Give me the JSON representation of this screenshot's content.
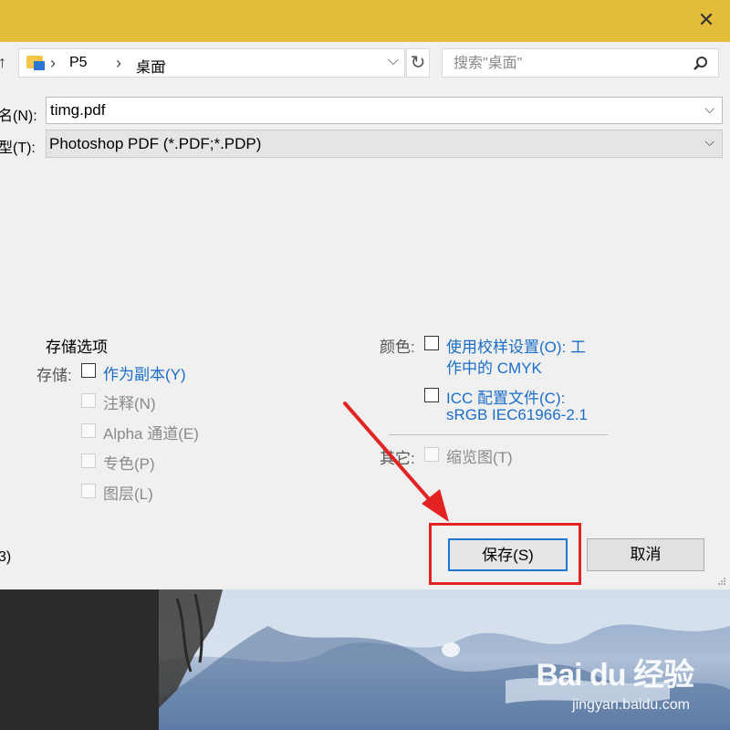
{
  "window": {
    "close_glyph": "✕"
  },
  "address": {
    "breadcrumbs": [
      "P5",
      "桌面"
    ],
    "separator": "›",
    "search_placeholder": "搜索\"桌面\""
  },
  "form": {
    "filename_label": "名(N):",
    "filename_value": "timg.pdf",
    "filetype_label": "型(T):",
    "filetype_value": "Photoshop PDF (*.PDF;*.PDP)"
  },
  "storage": {
    "title": "存储选项",
    "label": "存储:",
    "options": [
      {
        "label": "作为副本(Y)",
        "checked": false,
        "enabled": true
      },
      {
        "label": "注释(N)",
        "checked": false,
        "enabled": false
      },
      {
        "label": "Alpha 通道(E)",
        "checked": false,
        "enabled": false
      },
      {
        "label": "专色(P)",
        "checked": false,
        "enabled": false
      },
      {
        "label": "图层(L)",
        "checked": false,
        "enabled": false
      }
    ]
  },
  "color": {
    "label": "颜色:",
    "proof_line1": "使用校样设置(O):  工",
    "proof_line2": "作中的 CMYK",
    "icc_line1": "ICC 配置文件(C):",
    "icc_line2": "sRGB IEC61966-2.1"
  },
  "other": {
    "label": "其它:",
    "thumbnail": "缩览图(T)"
  },
  "buttons": {
    "save": "保存(S)",
    "cancel": "取消"
  },
  "left_partial": "3)",
  "watermark": {
    "brand": "Bai du 经验",
    "url": "jingyan.baidu.com"
  },
  "colors": {
    "titlebar": "#e4bd3a",
    "accent_link": "#1a6ec7",
    "annotation_red": "#e32222"
  }
}
